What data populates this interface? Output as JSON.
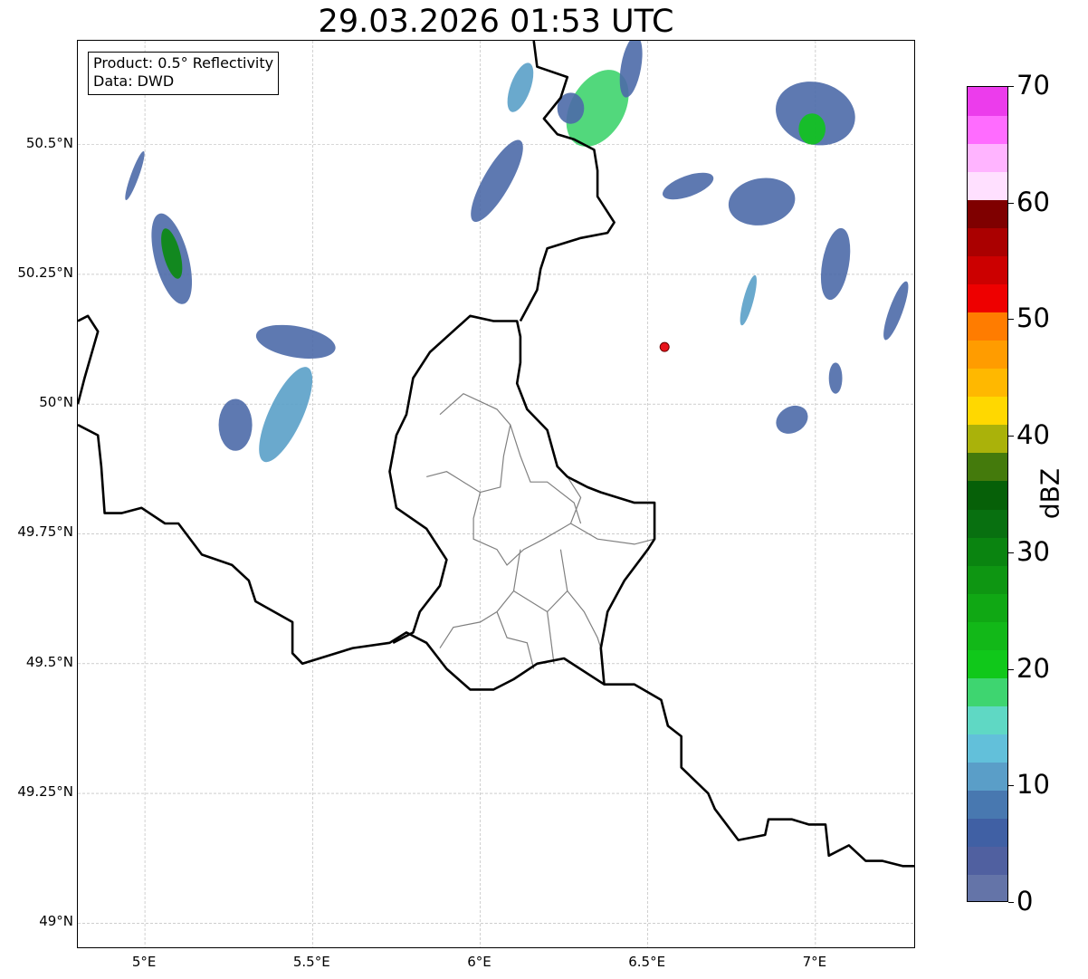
{
  "title": "29.03.2026 01:53 UTC",
  "info_box": {
    "line1": "Product: 0.5° Reflectivity",
    "line2": "Data: DWD"
  },
  "map": {
    "lon_range": [
      4.8,
      7.3
    ],
    "lat_range": [
      48.95,
      50.7
    ],
    "lat_ticks": [
      {
        "value": 50.5,
        "label": "50.5°N"
      },
      {
        "value": 50.25,
        "label": "50.25°N"
      },
      {
        "value": 50.0,
        "label": "50°N"
      },
      {
        "value": 49.75,
        "label": "49.75°N"
      },
      {
        "value": 49.5,
        "label": "49.5°N"
      },
      {
        "value": 49.25,
        "label": "49.25°N"
      },
      {
        "value": 49.0,
        "label": "49°N"
      }
    ],
    "lon_ticks": [
      {
        "value": 5.0,
        "label": "5°E"
      },
      {
        "value": 5.5,
        "label": "5.5°E"
      },
      {
        "value": 6.0,
        "label": "6°E"
      },
      {
        "value": 6.5,
        "label": "6.5°E"
      },
      {
        "value": 7.0,
        "label": "7°E"
      }
    ],
    "gridlines": true,
    "radar_site": {
      "lon": 6.55,
      "lat": 50.11,
      "color": "#e8121a"
    },
    "echo_colors": {
      "weak": "#4c6aa8",
      "light": "#5aa0c8",
      "moderate": "#3fd46e",
      "strong": "#10c41c",
      "heavy": "#0a8a10"
    },
    "national_border": [
      [
        [
          4.8,
          50.16
        ],
        [
          4.83,
          50.17
        ],
        [
          4.86,
          50.14
        ],
        [
          4.82,
          50.05
        ],
        [
          4.8,
          50.0
        ]
      ],
      [
        [
          4.8,
          49.96
        ],
        [
          4.86,
          49.94
        ],
        [
          4.87,
          49.88
        ],
        [
          4.88,
          49.79
        ],
        [
          4.93,
          49.79
        ],
        [
          4.99,
          49.8
        ],
        [
          5.06,
          49.77
        ],
        [
          5.1,
          49.77
        ],
        [
          5.17,
          49.71
        ],
        [
          5.26,
          49.69
        ],
        [
          5.31,
          49.66
        ],
        [
          5.33,
          49.62
        ],
        [
          5.44,
          49.58
        ],
        [
          5.44,
          49.52
        ],
        [
          5.47,
          49.5
        ],
        [
          5.62,
          49.53
        ],
        [
          5.73,
          49.54
        ],
        [
          5.78,
          49.56
        ],
        [
          5.84,
          49.54
        ],
        [
          5.9,
          49.49
        ],
        [
          5.97,
          49.45
        ],
        [
          6.04,
          49.45
        ],
        [
          6.1,
          49.47
        ],
        [
          6.17,
          49.5
        ],
        [
          6.25,
          49.51
        ],
        [
          6.37,
          49.46
        ],
        [
          6.46,
          49.46
        ],
        [
          6.54,
          49.43
        ],
        [
          6.56,
          49.38
        ],
        [
          6.6,
          49.36
        ],
        [
          6.6,
          49.3
        ],
        [
          6.68,
          49.25
        ],
        [
          6.7,
          49.22
        ],
        [
          6.77,
          49.16
        ],
        [
          6.85,
          49.17
        ],
        [
          6.86,
          49.2
        ],
        [
          6.93,
          49.2
        ],
        [
          6.98,
          49.19
        ],
        [
          7.03,
          49.19
        ],
        [
          7.04,
          49.13
        ],
        [
          7.1,
          49.15
        ],
        [
          7.15,
          49.12
        ],
        [
          7.2,
          49.12
        ],
        [
          7.26,
          49.11
        ],
        [
          7.3,
          49.11
        ]
      ],
      [
        [
          5.74,
          49.54
        ],
        [
          5.8,
          49.56
        ],
        [
          5.82,
          49.6
        ],
        [
          5.88,
          49.65
        ],
        [
          5.9,
          49.7
        ],
        [
          5.84,
          49.76
        ],
        [
          5.75,
          49.8
        ],
        [
          5.73,
          49.87
        ],
        [
          5.75,
          49.94
        ],
        [
          5.78,
          49.98
        ],
        [
          5.8,
          50.05
        ],
        [
          5.85,
          50.1
        ],
        [
          5.97,
          50.17
        ],
        [
          6.04,
          50.16
        ],
        [
          6.11,
          50.16
        ],
        [
          6.12,
          50.13
        ],
        [
          6.12,
          50.08
        ],
        [
          6.11,
          50.04
        ],
        [
          6.14,
          49.99
        ],
        [
          6.2,
          49.95
        ],
        [
          6.23,
          49.88
        ],
        [
          6.26,
          49.86
        ],
        [
          6.32,
          49.84
        ],
        [
          6.36,
          49.83
        ],
        [
          6.46,
          49.81
        ],
        [
          6.52,
          49.81
        ],
        [
          6.52,
          49.74
        ],
        [
          6.5,
          49.72
        ],
        [
          6.43,
          49.66
        ],
        [
          6.38,
          49.6
        ],
        [
          6.36,
          49.53
        ],
        [
          6.37,
          49.46
        ]
      ],
      [
        [
          6.12,
          50.16
        ],
        [
          6.17,
          50.22
        ],
        [
          6.18,
          50.26
        ],
        [
          6.2,
          50.3
        ],
        [
          6.3,
          50.32
        ],
        [
          6.38,
          50.33
        ],
        [
          6.4,
          50.35
        ],
        [
          6.35,
          50.4
        ],
        [
          6.35,
          50.45
        ],
        [
          6.34,
          50.49
        ],
        [
          6.28,
          50.51
        ],
        [
          6.23,
          50.52
        ],
        [
          6.19,
          50.55
        ],
        [
          6.24,
          50.59
        ],
        [
          6.26,
          50.63
        ],
        [
          6.17,
          50.65
        ],
        [
          6.16,
          50.7
        ]
      ]
    ],
    "region_border": [
      [
        [
          5.84,
          49.86
        ],
        [
          5.9,
          49.87
        ],
        [
          5.95,
          49.85
        ],
        [
          6.0,
          49.83
        ],
        [
          5.98,
          49.78
        ],
        [
          5.98,
          49.74
        ],
        [
          6.05,
          49.72
        ],
        [
          6.08,
          49.69
        ],
        [
          6.13,
          49.72
        ],
        [
          6.19,
          49.74
        ],
        [
          6.27,
          49.77
        ],
        [
          6.3,
          49.82
        ],
        [
          6.26,
          49.86
        ]
      ],
      [
        [
          5.88,
          49.98
        ],
        [
          5.95,
          50.02
        ],
        [
          6.05,
          49.99
        ],
        [
          6.09,
          49.96
        ],
        [
          6.07,
          49.9
        ],
        [
          6.06,
          49.84
        ],
        [
          6.0,
          49.83
        ]
      ],
      [
        [
          6.09,
          49.96
        ],
        [
          6.12,
          49.9
        ],
        [
          6.15,
          49.85
        ],
        [
          6.2,
          49.85
        ],
        [
          6.28,
          49.81
        ],
        [
          6.3,
          49.77
        ]
      ],
      [
        [
          6.12,
          49.72
        ],
        [
          6.1,
          49.64
        ],
        [
          6.05,
          49.6
        ],
        [
          6.0,
          49.58
        ],
        [
          5.92,
          49.57
        ],
        [
          5.88,
          49.53
        ]
      ],
      [
        [
          6.27,
          49.77
        ],
        [
          6.35,
          49.74
        ],
        [
          6.46,
          49.73
        ],
        [
          6.52,
          49.74
        ]
      ],
      [
        [
          6.24,
          49.72
        ],
        [
          6.26,
          49.64
        ],
        [
          6.31,
          49.6
        ],
        [
          6.35,
          49.55
        ],
        [
          6.36,
          49.53
        ]
      ],
      [
        [
          6.1,
          49.64
        ],
        [
          6.2,
          49.6
        ],
        [
          6.26,
          49.64
        ]
      ],
      [
        [
          6.05,
          49.6
        ],
        [
          6.08,
          49.55
        ],
        [
          6.14,
          49.54
        ],
        [
          6.16,
          49.49
        ]
      ],
      [
        [
          6.2,
          49.6
        ],
        [
          6.22,
          49.5
        ]
      ]
    ],
    "echoes": [
      {
        "intensity": "weak",
        "lon": 5.08,
        "lat": 50.28,
        "rx": 0.05,
        "ry": 0.09,
        "rot": -15
      },
      {
        "intensity": "heavy",
        "lon": 5.08,
        "lat": 50.29,
        "rx": 0.025,
        "ry": 0.05,
        "rot": -15
      },
      {
        "intensity": "weak",
        "lon": 4.97,
        "lat": 50.44,
        "rx": 0.012,
        "ry": 0.05,
        "rot": 20
      },
      {
        "intensity": "weak",
        "lon": 5.45,
        "lat": 50.12,
        "rx": 0.12,
        "ry": 0.03,
        "rot": 10
      },
      {
        "intensity": "weak",
        "lon": 5.27,
        "lat": 49.96,
        "rx": 0.05,
        "ry": 0.05,
        "rot": 0
      },
      {
        "intensity": "light",
        "lon": 5.42,
        "lat": 49.98,
        "rx": 0.05,
        "ry": 0.1,
        "rot": 25
      },
      {
        "intensity": "weak",
        "lon": 6.05,
        "lat": 50.43,
        "rx": 0.04,
        "ry": 0.09,
        "rot": 30
      },
      {
        "intensity": "light",
        "lon": 6.12,
        "lat": 50.61,
        "rx": 0.03,
        "ry": 0.05,
        "rot": 20
      },
      {
        "intensity": "moderate",
        "lon": 6.35,
        "lat": 50.57,
        "rx": 0.08,
        "ry": 0.08,
        "rot": 30
      },
      {
        "intensity": "weak",
        "lon": 6.45,
        "lat": 50.65,
        "rx": 0.03,
        "ry": 0.06,
        "rot": 10
      },
      {
        "intensity": "weak",
        "lon": 6.84,
        "lat": 50.39,
        "rx": 0.1,
        "ry": 0.045,
        "rot": -10
      },
      {
        "intensity": "weak",
        "lon": 6.62,
        "lat": 50.42,
        "rx": 0.08,
        "ry": 0.02,
        "rot": -20
      },
      {
        "intensity": "weak",
        "lon": 7.0,
        "lat": 50.56,
        "rx": 0.12,
        "ry": 0.06,
        "rot": 15
      },
      {
        "intensity": "strong",
        "lon": 6.99,
        "lat": 50.53,
        "rx": 0.04,
        "ry": 0.03,
        "rot": 0
      },
      {
        "intensity": "weak",
        "lon": 7.06,
        "lat": 50.27,
        "rx": 0.04,
        "ry": 0.07,
        "rot": 10
      },
      {
        "intensity": "light",
        "lon": 6.8,
        "lat": 50.2,
        "rx": 0.015,
        "ry": 0.05,
        "rot": 15
      },
      {
        "intensity": "weak",
        "lon": 6.93,
        "lat": 49.97,
        "rx": 0.05,
        "ry": 0.025,
        "rot": -30
      },
      {
        "intensity": "weak",
        "lon": 7.24,
        "lat": 50.18,
        "rx": 0.02,
        "ry": 0.06,
        "rot": 20
      },
      {
        "intensity": "weak",
        "lon": 7.06,
        "lat": 50.05,
        "rx": 0.02,
        "ry": 0.03,
        "rot": 0
      },
      {
        "intensity": "weak",
        "lon": 6.27,
        "lat": 50.57,
        "rx": 0.04,
        "ry": 0.03,
        "rot": 0
      }
    ]
  },
  "colorbar": {
    "label": "dBZ",
    "min": 0,
    "max": 70,
    "ticks": [
      "0",
      "10",
      "20",
      "30",
      "40",
      "50",
      "60",
      "70"
    ],
    "colors": [
      "#6474a8",
      "#5060a0",
      "#4060a4",
      "#4878b0",
      "#5a9ec8",
      "#62c0da",
      "#5fd8c4",
      "#3ed570",
      "#10c81a",
      "#12b818",
      "#10a814",
      "#0e9612",
      "#0a8410",
      "#087010",
      "#066008",
      "#447a0c",
      "#aab20a",
      "#ffd800",
      "#ffb800",
      "#ff9c00",
      "#ff7c00",
      "#ee0000",
      "#cc0000",
      "#aa0000",
      "#7f0000",
      "#ffe0ff",
      "#ffb4ff",
      "#ff6cff",
      "#ec3cec"
    ]
  }
}
